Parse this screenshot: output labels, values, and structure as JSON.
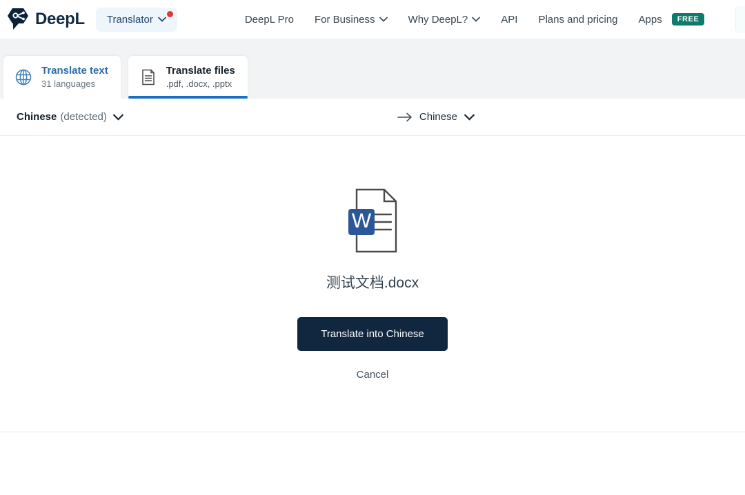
{
  "header": {
    "brand_name": "DeepL",
    "logo_icon": "deepl-logo-mark",
    "translator_pill": {
      "label": "Translator",
      "chevron_icon": "chevron-down-icon",
      "notification_dot": "red-dot-badge",
      "accent_color": "#e4362f",
      "background_color": "#eef5fb"
    },
    "nav_items": [
      {
        "label": "DeepL Pro",
        "has_chevron": false
      },
      {
        "label": "For Business",
        "has_chevron": true
      },
      {
        "label": "Why DeepL?",
        "has_chevron": true
      },
      {
        "label": "API",
        "has_chevron": false
      },
      {
        "label": "Plans and pricing",
        "has_chevron": false
      },
      {
        "label": "Apps",
        "has_chevron": false,
        "badge": "FREE"
      }
    ],
    "badge_color": "#0f7b6c"
  },
  "tabs": [
    {
      "title": "Translate text",
      "subtitle": "31 languages",
      "icon": "globe-icon",
      "active": false
    },
    {
      "title": "Translate files",
      "subtitle": ".pdf, .docx, .pptx",
      "icon": "document-icon",
      "active": true
    }
  ],
  "language_bar": {
    "source_language": "Chinese",
    "source_detected_note": "(detected)",
    "source_chevron_icon": "chevron-down-icon",
    "direction_icon": "arrow-right-icon",
    "target_language": "Chinese",
    "target_chevron_icon": "chevron-down-icon"
  },
  "main": {
    "file_icon": "word-document-icon",
    "file_icon_badge_letter": "W",
    "file_icon_badge_color": "#2b579a",
    "filename": "测试文档.docx",
    "primary_button_label": "Translate into Chinese",
    "primary_button_color": "#11273f",
    "cancel_label": "Cancel"
  }
}
